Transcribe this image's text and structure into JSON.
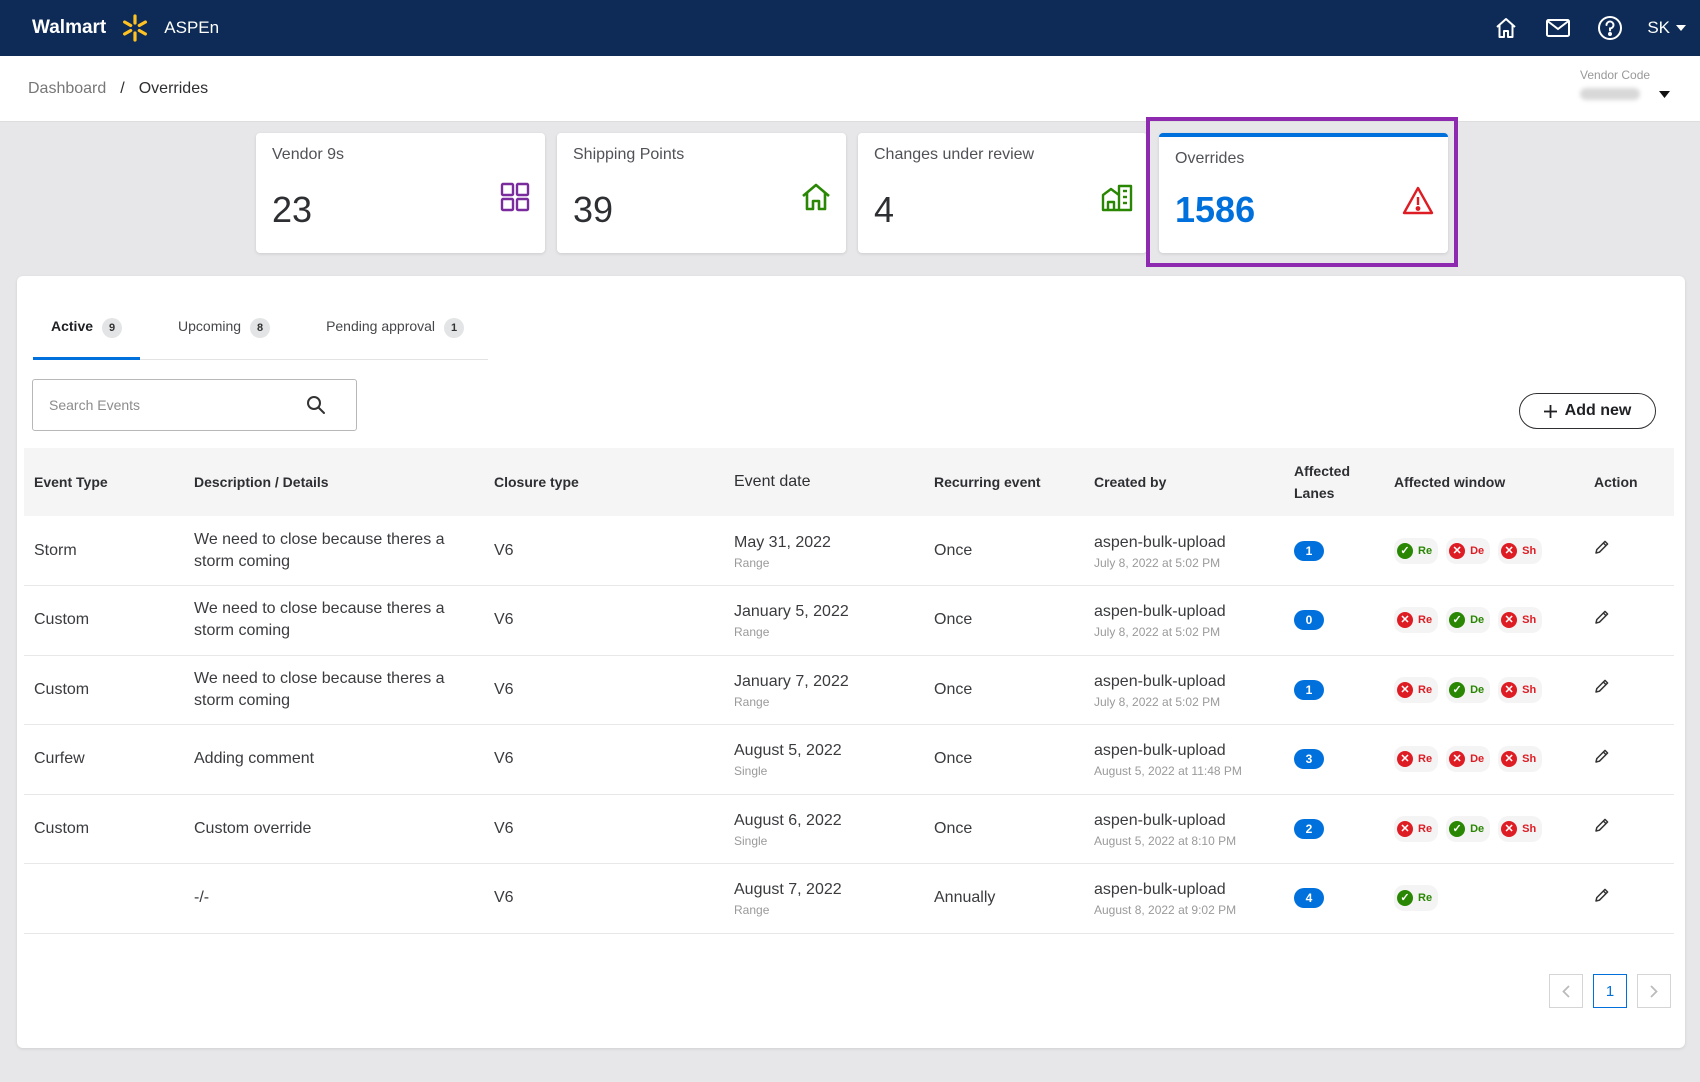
{
  "header": {
    "brand": "Walmart",
    "app_name": "ASPEn",
    "user": "SK"
  },
  "breadcrumb": {
    "root": "Dashboard",
    "separator": "/",
    "current": "Overrides"
  },
  "vendor_code": {
    "label": "Vendor Code"
  },
  "stats": [
    {
      "title": "Vendor 9s",
      "value": "23",
      "icon": "grid-icon"
    },
    {
      "title": "Shipping Points",
      "value": "39",
      "icon": "home-icon"
    },
    {
      "title": "Changes under review",
      "value": "4",
      "icon": "building-icon"
    },
    {
      "title": "Overrides",
      "value": "1586",
      "icon": "warning-icon"
    }
  ],
  "tabs": [
    {
      "label": "Active",
      "count": "9"
    },
    {
      "label": "Upcoming",
      "count": "8"
    },
    {
      "label": "Pending approval",
      "count": "1"
    }
  ],
  "search": {
    "placeholder": "Search Events"
  },
  "add_button": {
    "label": "Add new"
  },
  "table": {
    "headers": {
      "event_type": "Event Type",
      "description": "Description / Details",
      "closure": "Closure type",
      "event_date": "Event date",
      "recurring": "Recurring event",
      "created_by": "Created by",
      "lanes_line1": "Affected",
      "lanes_line2": "Lanes",
      "window": "Affected window",
      "action": "Action"
    },
    "rows": [
      {
        "event_type": "Storm",
        "description": "We need to close because theres a storm coming",
        "closure": "V6",
        "date": "May 31, 2022",
        "date_kind": "Range",
        "recurring": "Once",
        "creator": "aspen-bulk-upload",
        "created_at": "July 8, 2022 at 5:02 PM",
        "lanes": "1",
        "windows": [
          {
            "label": "Re",
            "ok": true
          },
          {
            "label": "De",
            "ok": false
          },
          {
            "label": "Sh",
            "ok": false
          }
        ]
      },
      {
        "event_type": "Custom",
        "description": "We need to close because theres a storm coming",
        "closure": "V6",
        "date": "January 5, 2022",
        "date_kind": "Range",
        "recurring": "Once",
        "creator": "aspen-bulk-upload",
        "created_at": "July 8, 2022 at 5:02 PM",
        "lanes": "0",
        "windows": [
          {
            "label": "Re",
            "ok": false
          },
          {
            "label": "De",
            "ok": true
          },
          {
            "label": "Sh",
            "ok": false
          }
        ]
      },
      {
        "event_type": "Custom",
        "description": "We need to close because theres a storm coming",
        "closure": "V6",
        "date": "January 7, 2022",
        "date_kind": "Range",
        "recurring": "Once",
        "creator": "aspen-bulk-upload",
        "created_at": "July 8, 2022 at 5:02 PM",
        "lanes": "1",
        "windows": [
          {
            "label": "Re",
            "ok": false
          },
          {
            "label": "De",
            "ok": true
          },
          {
            "label": "Sh",
            "ok": false
          }
        ]
      },
      {
        "event_type": "Curfew",
        "description": "Adding comment",
        "closure": "V6",
        "date": "August 5, 2022",
        "date_kind": "Single",
        "recurring": "Once",
        "creator": "aspen-bulk-upload",
        "created_at": "August 5, 2022 at 11:48 PM",
        "lanes": "3",
        "windows": [
          {
            "label": "Re",
            "ok": false
          },
          {
            "label": "De",
            "ok": false
          },
          {
            "label": "Sh",
            "ok": false
          }
        ]
      },
      {
        "event_type": "Custom",
        "description": "Custom override",
        "closure": "V6",
        "date": "August 6, 2022",
        "date_kind": "Single",
        "recurring": "Once",
        "creator": "aspen-bulk-upload",
        "created_at": "August 5, 2022 at 8:10 PM",
        "lanes": "2",
        "windows": [
          {
            "label": "Re",
            "ok": false
          },
          {
            "label": "De",
            "ok": true
          },
          {
            "label": "Sh",
            "ok": false
          }
        ]
      },
      {
        "event_type": "",
        "description": "-/-",
        "closure": "V6",
        "date": "August 7, 2022",
        "date_kind": "Range",
        "recurring": "Annually",
        "creator": "aspen-bulk-upload",
        "created_at": "August 8, 2022 at 9:02 PM",
        "lanes": "4",
        "windows": [
          {
            "label": "Re",
            "ok": true
          }
        ]
      }
    ]
  },
  "pagination": {
    "current": "1"
  },
  "colors": {
    "nav": "#0d2b56",
    "accent": "#0071dc",
    "spark": "#ffc220",
    "highlight": "#8d2ab0",
    "ok": "#2a8703",
    "error": "#de1c24"
  }
}
